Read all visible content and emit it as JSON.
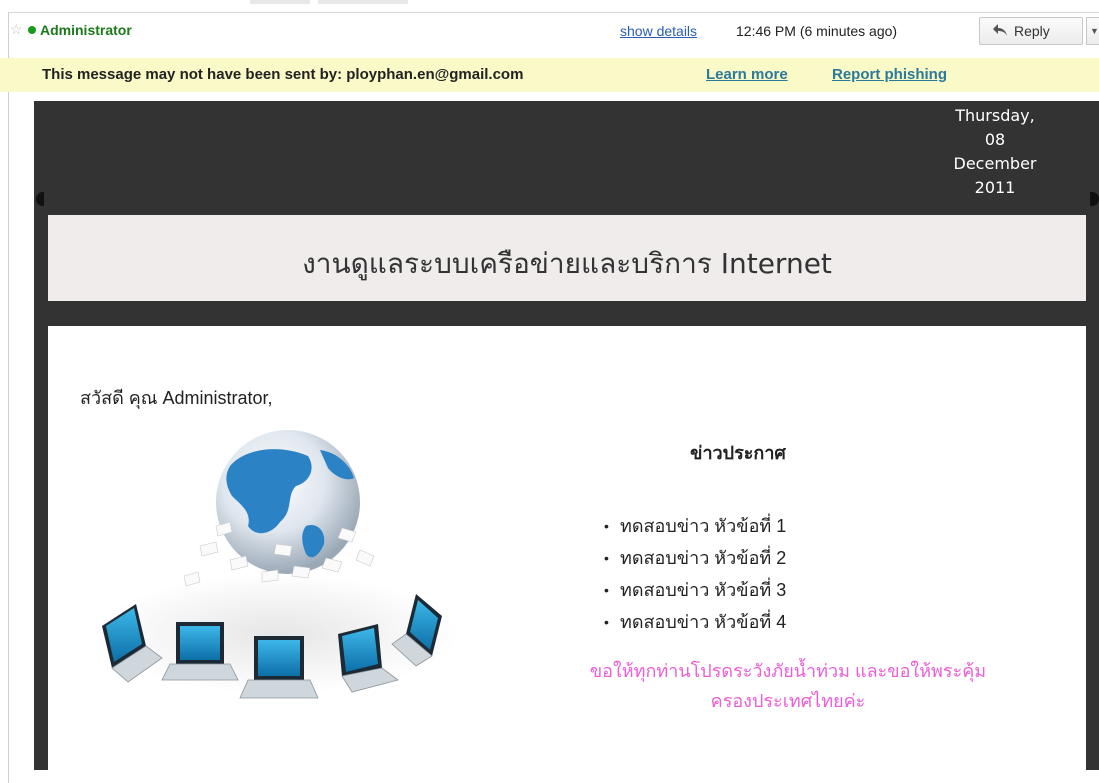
{
  "message_header": {
    "sender": "Administrator",
    "show_details_label": "show details",
    "timestamp": "12:46 PM (6 minutes ago)",
    "reply_label": "Reply",
    "star_icon": "star-icon",
    "reply_icon": "reply-arrow-icon"
  },
  "warning": {
    "text": "This message may not have been sent by: ployphan.en@gmail.com",
    "learn_more": "Learn more",
    "report_phishing": "Report phishing"
  },
  "email": {
    "date_lines": [
      "Thursday,",
      "08",
      "December",
      "2011"
    ],
    "title": "งานดูแลระบบเครือข่ายและบริการ Internet",
    "greeting": "สวัสดี คุณ Administrator,",
    "announcement_title": "ข่าวประกาศ",
    "news_items": [
      "ทดสอบข่าว หัวข้อที่ 1",
      "ทดสอบข่าว หัวข้อที่ 2",
      "ทดสอบข่าว หัวข้อที่ 3",
      "ทดสอบข่าว หัวข้อที่ 4"
    ],
    "notice_lines": [
      "ขอให้ทุกท่านโปรดระวังภัยน้ำท่วม และขอให้พระคุ้ม",
      "ครองประเทศไทยค่ะ"
    ]
  },
  "colors": {
    "sender_green": "#1a7a1a",
    "link_blue": "#2a5db0",
    "warning_bg": "#fafac8",
    "email_dark": "#333333",
    "title_band": "#f0ecec",
    "notice_pink": "#ec5ed6"
  }
}
